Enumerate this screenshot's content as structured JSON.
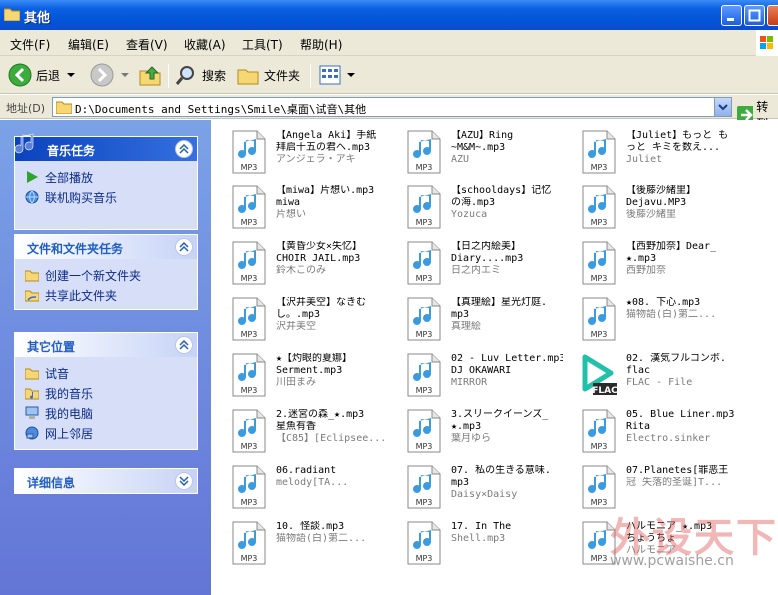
{
  "window": {
    "title": "其他"
  },
  "menu": [
    "文件(F)",
    "编辑(E)",
    "查看(V)",
    "收藏(A)",
    "工具(T)",
    "帮助(H)"
  ],
  "toolbar": {
    "back": "后退",
    "search": "搜索",
    "folders": "文件夹"
  },
  "address": {
    "label": "地址(D)",
    "path": "D:\\Documents and Settings\\Smile\\桌面\\试音\\其他",
    "go": "转到"
  },
  "panels": {
    "music": {
      "title": "音乐任务",
      "items": [
        "全部播放",
        "联机购买音乐"
      ]
    },
    "file_tasks": {
      "title": "文件和文件夹任务",
      "items": [
        "创建一个新文件夹",
        "共享此文件夹"
      ]
    },
    "other_places": {
      "title": "其它位置",
      "items": [
        "试音",
        "我的音乐",
        "我的电脑",
        "网上邻居"
      ]
    },
    "details": {
      "title": "详细信息"
    }
  },
  "files": [
    {
      "l1": "【Angela Aki】手紙",
      "l2": "拜启十五の君へ.mp3",
      "l3": "アンジェラ・アキ",
      "type": "mp3"
    },
    {
      "l1": "【AZU】Ring",
      "l2": "~M&M~.mp3",
      "l3": "AZU",
      "type": "mp3"
    },
    {
      "l1": "【Juliet】もっと も",
      "l2": "っと キミを数え...",
      "l3": "Juliet",
      "type": "mp3"
    },
    {
      "l1": "【miwa】片想い.mp3",
      "l2": "miwa",
      "l3": "片想い",
      "type": "mp3"
    },
    {
      "l1": "【schooldays】记忆",
      "l2": "の海.mp3",
      "l3": "Yozuca",
      "type": "mp3"
    },
    {
      "l1": "【後藤沙緒里】",
      "l2": "Dejavu.MP3",
      "l3": "後藤沙緒里",
      "type": "mp3"
    },
    {
      "l1": "【黄昏少女×失忆】",
      "l2": "CHOIR JAIL.mp3",
      "l3": "鈴木このみ",
      "type": "mp3"
    },
    {
      "l1": "【日之内絵美】",
      "l2": "Diary....mp3",
      "l3": "日之内エミ",
      "type": "mp3"
    },
    {
      "l1": "【西野加奈】Dear_",
      "l2": "★.mp3",
      "l3": "西野加奈",
      "type": "mp3"
    },
    {
      "l1": "【沢井美空】なきむ",
      "l2": "し。.mp3",
      "l3": "沢井美空",
      "type": "mp3"
    },
    {
      "l1": "【真理絵】星光灯庭.",
      "l2": "mp3",
      "l3": "真理絵",
      "type": "mp3"
    },
    {
      "l1": "★08. 下心.mp3",
      "l2": "猫物語(白)第二...",
      "l3": "",
      "type": "mp3"
    },
    {
      "l1": "★【灼眼的夏娜】",
      "l2": "Serment.mp3",
      "l3": "川田まみ",
      "type": "mp3"
    },
    {
      "l1": "02 - Luv Letter.mp3",
      "l2": "DJ OKAWARI",
      "l3": "MIRROR",
      "type": "mp3"
    },
    {
      "l1": "02. 漢気フルコンボ.",
      "l2": "flac",
      "l3": "FLAC - File",
      "type": "flac"
    },
    {
      "l1": "2.迷宮の森_★.mp3",
      "l2": "星魚有香",
      "l3": "【C85】[Eclipsee...",
      "type": "mp3"
    },
    {
      "l1": "3.スリークイーンズ_",
      "l2": "★.mp3",
      "l3": "葉月ゆら",
      "type": "mp3"
    },
    {
      "l1": "05. Blue Liner.mp3",
      "l2": "Rita",
      "l3": "Electro.sinker",
      "type": "mp3"
    },
    {
      "l1": "06.radiant",
      "l2": "melody[TA...",
      "l3": "",
      "type": "mp3"
    },
    {
      "l1": "07. 私の生きる意味.",
      "l2": "mp3",
      "l3": "Daisy×Daisy",
      "type": "mp3"
    },
    {
      "l1": "07.Planetes[罪恶王",
      "l2": "冠 失落的圣诞]T...",
      "l3": "",
      "type": "mp3"
    },
    {
      "l1": "10. 怪談.mp3",
      "l2": "猫物語(白)第二...",
      "l3": "",
      "type": "mp3"
    },
    {
      "l1": "17. In The",
      "l2": "Shell.mp3",
      "l3": "",
      "type": "mp3"
    },
    {
      "l1": "ハルモニア_★.mp3",
      "l2": "ちょうちょ",
      "l3": "ハルモニア",
      "type": "mp3"
    }
  ],
  "watermark": {
    "text": "外设天下",
    "url": "www.pcwaishe.cn"
  },
  "icon_label": "MP3",
  "flac_label": "FLAC",
  "colors": {
    "title_blue": "#0454d8",
    "sidebar_blue": "#6375d6",
    "task_link": "#0c2a8c"
  }
}
